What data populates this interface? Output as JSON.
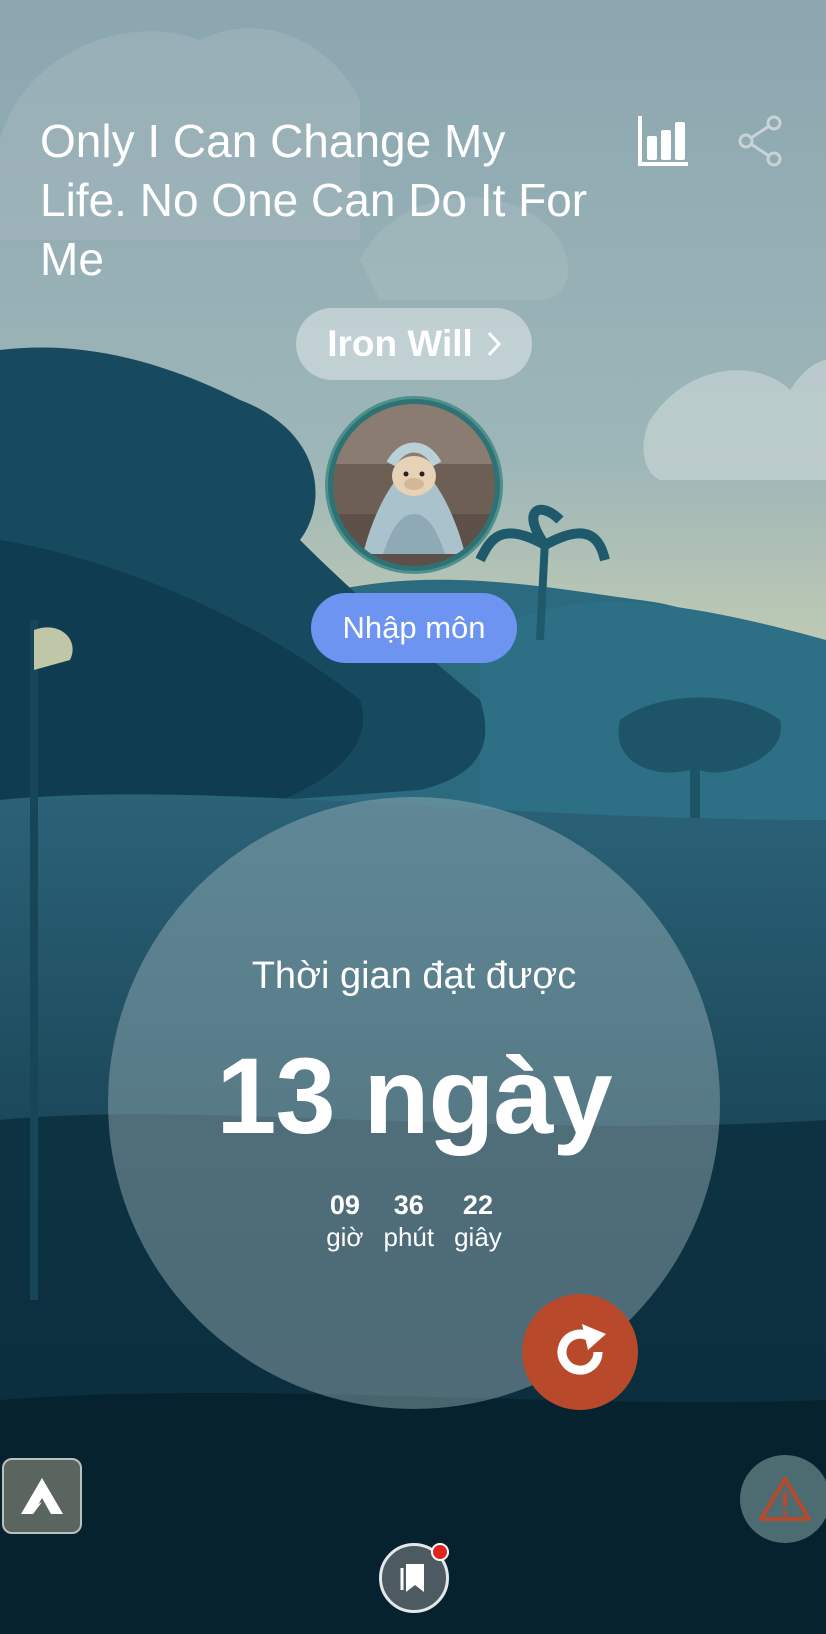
{
  "header": {
    "quote": "Only I Can Change My Life. No One Can Do It For Me",
    "stats_icon": "bar-chart-icon",
    "share_icon": "share-icon"
  },
  "habit": {
    "category": "Iron Will",
    "level": "Nhập môn"
  },
  "timer": {
    "label": "Thời gian đạt được",
    "days": "13 ngày",
    "hours": "09",
    "hours_label": "giờ",
    "minutes": "36",
    "minutes_label": "phút",
    "seconds": "22",
    "seconds_label": "giây"
  },
  "actions": {
    "reset_icon": "reset-icon",
    "alert_icon": "warning-icon",
    "bookmark_icon": "bookmark-icon",
    "logo_icon": "app-logo-icon"
  },
  "colors": {
    "reset": "#b8492a",
    "level_badge": "#6d94f0",
    "notification": "#e2241f"
  }
}
